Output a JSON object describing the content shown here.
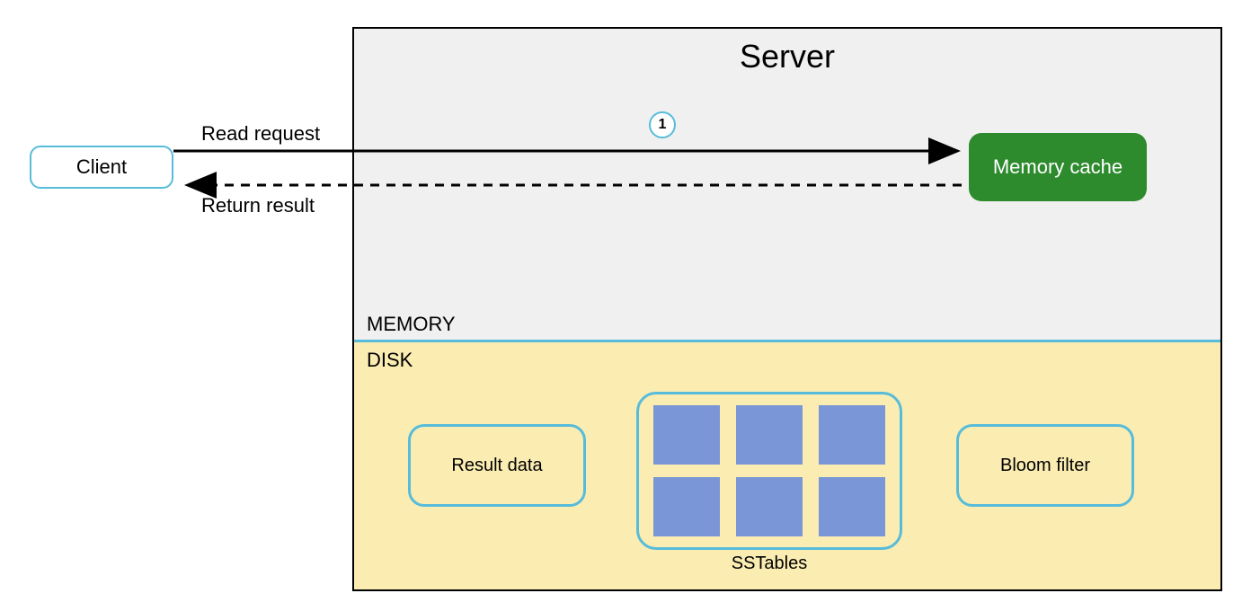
{
  "client": {
    "label": "Client"
  },
  "server": {
    "title": "Server"
  },
  "sections": {
    "memory": "MEMORY",
    "disk": "DISK"
  },
  "arrows": {
    "request_label": "Read request",
    "return_label": "Return result",
    "step1": "1"
  },
  "memory_cache": {
    "label": "Memory cache"
  },
  "disk_items": {
    "result_data": "Result data",
    "sstables_label": "SSTables",
    "bloom_filter": "Bloom filter"
  }
}
